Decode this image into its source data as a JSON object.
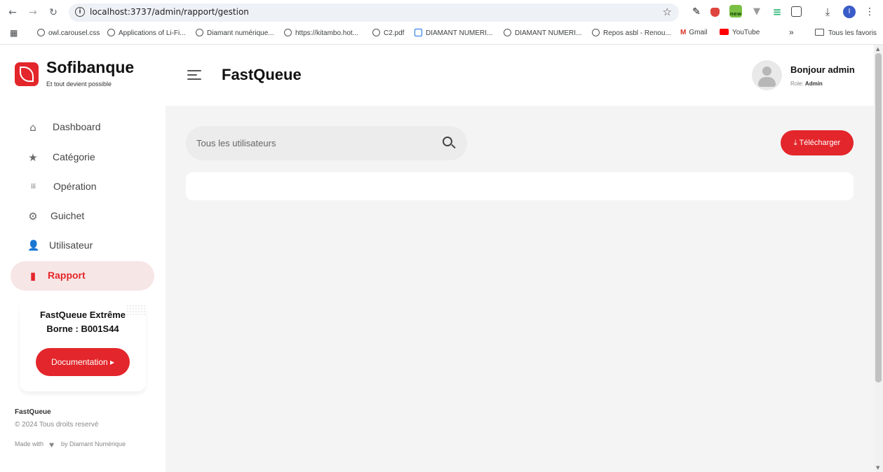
{
  "browser": {
    "url": "localhost:3737/admin/rapport/gestion",
    "bookmarks": [
      "owl.carousel.css",
      "Applications of Li-Fi...",
      "Diamant numérique...",
      "https://kitambo.hot...",
      "C2.pdf",
      "DIAMANT NUMERI...",
      "DIAMANT NUMERI...",
      "Repos asbl - Renou...",
      "Gmail",
      "YouTube"
    ],
    "more_label": "»",
    "all_bookmarks": "Tous les favoris",
    "ext_new_badge": "new"
  },
  "sidebar": {
    "brand": "Sofibanque",
    "tagline": "Et tout devient possible",
    "items": [
      {
        "label": "Dashboard",
        "icon": "home-icon"
      },
      {
        "label": "Catégorie",
        "icon": "star-icon"
      },
      {
        "label": "Opération",
        "icon": "grid-dots-icon"
      },
      {
        "label": "Guichet",
        "icon": "gear-icon"
      },
      {
        "label": "Utilisateur",
        "icon": "user-icon"
      },
      {
        "label": "Rapport",
        "icon": "file-icon",
        "active": true
      }
    ],
    "promo": {
      "line1": "FastQueue Extrême",
      "line2": "Borne : B001S44",
      "button": "Documentation ▸"
    },
    "footer": {
      "brand": "FastQueue",
      "copyright": "© 2024 Tous droits reservé",
      "made_with": "Made with",
      "by": "by Diamant Numérique"
    }
  },
  "header": {
    "title": "FastQueue",
    "greeting": "Bonjour admin",
    "role_label": "Role:",
    "role_value": "Admin"
  },
  "main": {
    "search_placeholder": "Tous les utilisateurs",
    "download_button": "Télécharger"
  },
  "colors": {
    "accent": "#e3262b",
    "active_bg": "#f7e6e6",
    "main_bg": "#f4f4f4"
  }
}
